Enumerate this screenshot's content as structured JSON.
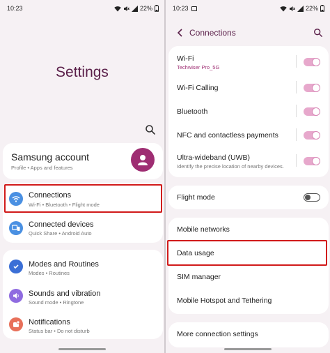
{
  "colors": {
    "accent": "#9e2d72",
    "title": "#5a1f49",
    "highlight": "#d11a1a",
    "toggle_on": "#e7a8cc"
  },
  "left": {
    "status": {
      "time": "10:23",
      "battery": "22%"
    },
    "title": "Settings",
    "account": {
      "title": "Samsung account",
      "subtitle": "Profile  •  Apps and features"
    },
    "group1": [
      {
        "title": "Connections",
        "subtitle": "Wi-Fi  •  Bluetooth  •  Flight mode",
        "icon": "wifi-icon",
        "color": "#4a90e2"
      },
      {
        "title": "Connected devices",
        "subtitle": "Quick Share  •  Android Auto",
        "icon": "connected-devices-icon",
        "color": "#4a90e2"
      }
    ],
    "group2": [
      {
        "title": "Modes and Routines",
        "subtitle": "Modes  •  Routines",
        "icon": "routines-icon",
        "color": "#3b6fd6"
      },
      {
        "title": "Sounds and vibration",
        "subtitle": "Sound mode  •  Ringtone",
        "icon": "volume-icon",
        "color": "#8f6be0"
      },
      {
        "title": "Notifications",
        "subtitle": "Status bar  •  Do not disturb",
        "icon": "notifications-icon",
        "color": "#e8705a"
      }
    ]
  },
  "right": {
    "status": {
      "time": "10:23",
      "battery": "22%"
    },
    "header": "Connections",
    "group1": [
      {
        "title": "Wi-Fi",
        "subtitle": "Techwiser Pro_5G",
        "on": true
      },
      {
        "title": "Wi-Fi Calling",
        "subtitle": "",
        "on": true
      },
      {
        "title": "Bluetooth",
        "subtitle": "",
        "on": true
      },
      {
        "title": "NFC and contactless payments",
        "subtitle": "",
        "on": true
      },
      {
        "title": "Ultra-wideband (UWB)",
        "subtitle": "Identify the precise location of nearby devices.",
        "on": true
      }
    ],
    "flight": {
      "title": "Flight mode",
      "on": false
    },
    "group3": [
      {
        "title": "Mobile networks"
      },
      {
        "title": "Data usage"
      },
      {
        "title": "SIM manager"
      },
      {
        "title": "Mobile Hotspot and Tethering"
      }
    ],
    "more": {
      "title": "More connection settings"
    }
  }
}
